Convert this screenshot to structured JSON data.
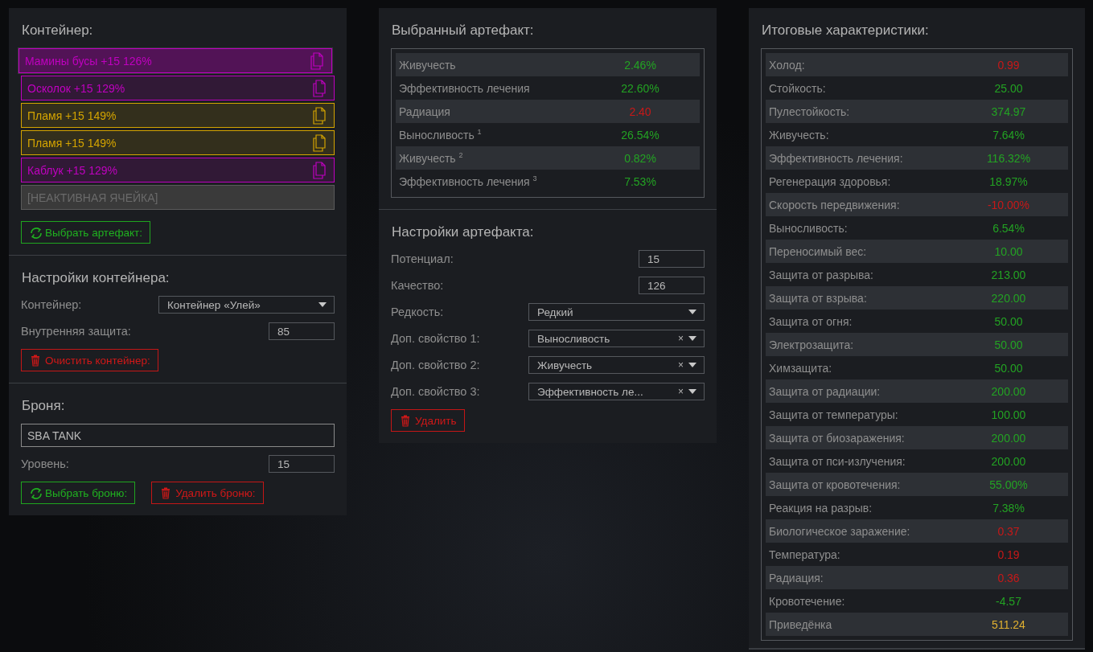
{
  "container_panel": {
    "title": "Контейнер:",
    "slots": [
      {
        "kind": "artifact",
        "label": "Мамины бусы +15 126%",
        "color": "#c000c0",
        "selected": true
      },
      {
        "kind": "artifact",
        "label": "Осколок +15 129%",
        "color": "#c000c0",
        "selected": false
      },
      {
        "kind": "artifact",
        "label": "Пламя +15 149%",
        "color": "#d4a400",
        "selected": false
      },
      {
        "kind": "artifact",
        "label": "Пламя +15 149%",
        "color": "#d4a400",
        "selected": false
      },
      {
        "kind": "artifact",
        "label": "Каблук +15 129%",
        "color": "#c000c0",
        "selected": false
      },
      {
        "kind": "inactive",
        "label": "[НЕАКТИВНАЯ ЯЧЕЙКА]"
      }
    ],
    "choose_button": {
      "kind": "choose",
      "label": "Выбрать артефакт:"
    }
  },
  "container_settings": {
    "title": "Настройки контейнера:",
    "fields": [
      {
        "kind": "select",
        "label": "Контейнер:",
        "value": "Контейнер «Улей»"
      },
      {
        "kind": "number",
        "label": "Внутренняя защита:",
        "value": "85"
      }
    ],
    "buttons": [
      {
        "kind": "delete",
        "label": "Очистить контейнер:"
      }
    ]
  },
  "armor": {
    "title": "Броня:",
    "name_value": "SBA TANK",
    "fields": [
      {
        "kind": "number",
        "label": "Уровень:",
        "value": "15"
      }
    ],
    "buttons": [
      {
        "kind": "choose",
        "label": "Выбрать броню:"
      },
      {
        "kind": "delete",
        "label": "Удалить броню:"
      }
    ]
  },
  "selected_artifact": {
    "title": "Выбранный артефакт:",
    "rows": [
      {
        "name": "Живучесть",
        "value": "2.46%",
        "color": "#23a323"
      },
      {
        "name": "Эффективность лечения",
        "value": "22.60%",
        "color": "#23a323"
      },
      {
        "name": "Радиация",
        "value": "2.40",
        "color": "#c81818"
      },
      {
        "name": "Выносливость $^{1}$",
        "value": "26.54%",
        "color": "#23a323"
      },
      {
        "name": "Живучесть $^{2}$",
        "value": "0.82%",
        "color": "#23a323"
      },
      {
        "name": "Эффективность лечения $^{3}$",
        "value": "7.53%",
        "color": "#23a323"
      }
    ]
  },
  "artifact_settings": {
    "title": "Настройки артефакта:",
    "fields": [
      {
        "kind": "number",
        "label": "Потенциал:",
        "value": "15"
      },
      {
        "kind": "number",
        "label": "Качество:",
        "value": "126"
      },
      {
        "kind": "select",
        "label": "Редкость:",
        "value": "Редкий"
      },
      {
        "kind": "select",
        "label": "Доп. свойство 1:",
        "value": "Выносливость",
        "clear": "×"
      },
      {
        "kind": "select",
        "label": "Доп. свойство 2:",
        "value": "Живучесть",
        "clear": "×"
      },
      {
        "kind": "select",
        "label": "Доп. свойство 3:",
        "value": "Эффективность ле...",
        "clear": "×"
      }
    ],
    "buttons": [
      {
        "kind": "delete",
        "label": "Удалить"
      }
    ]
  },
  "totals": {
    "title": "Итоговые характеристики:",
    "rows": [
      {
        "name": "Холод:",
        "value": "0.99",
        "color": "#c81818"
      },
      {
        "name": "Стойкость:",
        "value": "25.00",
        "color": "#23a323"
      },
      {
        "name": "Пулестойкость:",
        "value": "374.97",
        "color": "#23a323"
      },
      {
        "name": "Живучесть:",
        "value": "7.64%",
        "color": "#23a323"
      },
      {
        "name": "Эффективность лечения:",
        "value": "116.32%",
        "color": "#23a323"
      },
      {
        "name": "Регенерация здоровья:",
        "value": "18.97%",
        "color": "#23a323"
      },
      {
        "name": "Скорость передвижения:",
        "value": "-10.00%",
        "color": "#c81818"
      },
      {
        "name": "Выносливость:",
        "value": "6.54%",
        "color": "#23a323"
      },
      {
        "name": "Переносимый вес:",
        "value": "10.00",
        "color": "#23a323"
      },
      {
        "name": "Защита от разрыва:",
        "value": "213.00",
        "color": "#23a323"
      },
      {
        "name": "Защита от взрыва:",
        "value": "220.00",
        "color": "#23a323"
      },
      {
        "name": "Защита от огня:",
        "value": "50.00",
        "color": "#23a323"
      },
      {
        "name": "Электрозащита:",
        "value": "50.00",
        "color": "#23a323"
      },
      {
        "name": "Химзащита:",
        "value": "50.00",
        "color": "#23a323"
      },
      {
        "name": "Защита от радиации:",
        "value": "200.00",
        "color": "#23a323"
      },
      {
        "name": "Защита от температуры:",
        "value": "100.00",
        "color": "#23a323"
      },
      {
        "name": "Защита от биозаражения:",
        "value": "200.00",
        "color": "#23a323"
      },
      {
        "name": "Защита от пси-излучения:",
        "value": "200.00",
        "color": "#23a323"
      },
      {
        "name": "Защита от кровотечения:",
        "value": "55.00%",
        "color": "#23a323"
      },
      {
        "name": "Реакция на разрыв:",
        "value": "7.38%",
        "color": "#23a323"
      },
      {
        "name": "Биологическое заражение:",
        "value": "0.37",
        "color": "#c81818"
      },
      {
        "name": "Температура:",
        "value": "0.19",
        "color": "#c81818"
      },
      {
        "name": "Радиация:",
        "value": "0.36",
        "color": "#c81818"
      },
      {
        "name": "Кровотечение:",
        "value": "-4.57",
        "color": "#23a323"
      },
      {
        "name": "Приведёнка",
        "value": "511.24",
        "color": "#e0b030"
      }
    ]
  }
}
